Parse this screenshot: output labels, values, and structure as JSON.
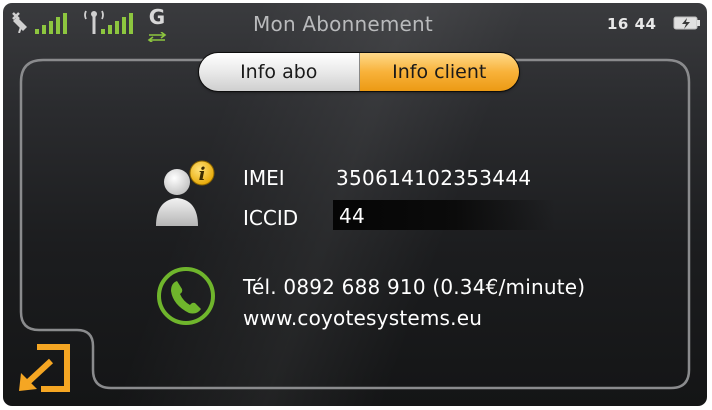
{
  "status_bar": {
    "title": "Mon Abonnement",
    "time": "16 44",
    "network_letter": "G",
    "icons": [
      "gps-satellite-icon",
      "signal-bars-icon",
      "antenna-icon",
      "signal-bars-icon",
      "gprs-icon",
      "battery-charging-icon"
    ]
  },
  "tabs": [
    {
      "label": "Info abo",
      "selected": false
    },
    {
      "label": "Info client",
      "selected": true
    }
  ],
  "device_info": {
    "imei_label": "IMEI",
    "imei_value": "350614102353444",
    "iccid_label": "ICCID",
    "iccid_value": "44"
  },
  "contact": {
    "phone": "Tél. 0892 688 910   (0.34€/minute)",
    "website": "www.coyotesystems.eu"
  },
  "colors": {
    "accent_orange": "#f5a623",
    "signal_green": "#8dc63f",
    "icon_green": "#6fb52c",
    "background_dark": "#1c1d1f"
  },
  "icons": {
    "back": "back-arrow-icon",
    "user_info": "user-info-icon",
    "phone": "phone-icon"
  }
}
